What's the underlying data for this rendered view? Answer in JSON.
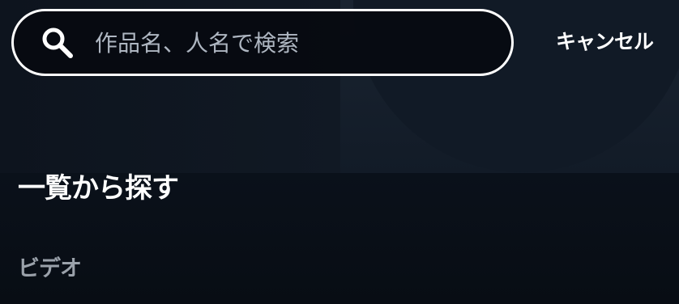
{
  "search": {
    "placeholder": "作品名、人名で検索",
    "value": "",
    "icon": "search-icon"
  },
  "header": {
    "cancel_label": "キャンセル"
  },
  "main": {
    "section_title": "一覧から探す",
    "categories": [
      {
        "label": "ビデオ"
      }
    ]
  },
  "colors": {
    "background": "#0b111a",
    "text_primary": "#ffffff",
    "text_secondary": "#9aa1aa",
    "search_border": "#ffffff"
  }
}
